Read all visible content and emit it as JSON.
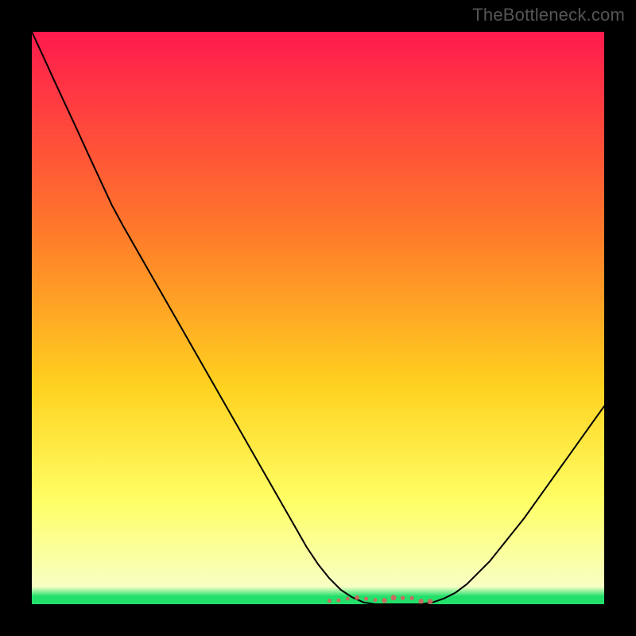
{
  "watermark": "TheBottleneck.com",
  "colors": {
    "frame": "#000000",
    "grad_top": "#ff1a4d",
    "grad_mid1": "#ff7a2a",
    "grad_mid2": "#ffd21f",
    "grad_mid3": "#ffff66",
    "grad_bottom": "#f6ffd6",
    "green_band": "#22e06a",
    "curve": "#000000",
    "red_dots": "#d86060",
    "watermark": "#555555"
  },
  "chart_data": {
    "type": "line",
    "title": "",
    "xlabel": "",
    "ylabel": "",
    "xlim": [
      0,
      100
    ],
    "ylim": [
      0,
      100
    ],
    "x": [
      0,
      2,
      4,
      6,
      8,
      10,
      12,
      14,
      16,
      18,
      20,
      22,
      24,
      26,
      28,
      30,
      32,
      34,
      36,
      38,
      40,
      42,
      44,
      46,
      48,
      50,
      52,
      54,
      56,
      58,
      60,
      62,
      64,
      66,
      68,
      70,
      72,
      74,
      76,
      78,
      80,
      82,
      84,
      86,
      88,
      90,
      92,
      94,
      96,
      98,
      100
    ],
    "values": [
      100,
      95.7,
      91.3,
      87.0,
      82.7,
      78.3,
      74.0,
      69.7,
      66.0,
      62.5,
      59.0,
      55.5,
      52.0,
      48.5,
      45.0,
      41.5,
      38.0,
      34.5,
      31.0,
      27.5,
      24.0,
      20.5,
      17.0,
      13.5,
      10.0,
      7.0,
      4.5,
      2.5,
      1.2,
      0.3,
      0,
      0,
      0,
      0,
      0,
      0.3,
      1.0,
      2.0,
      3.5,
      5.5,
      7.5,
      10.0,
      12.5,
      15.0,
      17.8,
      20.6,
      23.4,
      26.2,
      29.0,
      31.8,
      34.6
    ],
    "red_dot_band": {
      "x_min": 52,
      "x_max": 70,
      "y": 0.8,
      "description": "cluster of short red marks along the bottom near the curve minimum"
    },
    "green_band_y_range": [
      0,
      3
    ]
  }
}
